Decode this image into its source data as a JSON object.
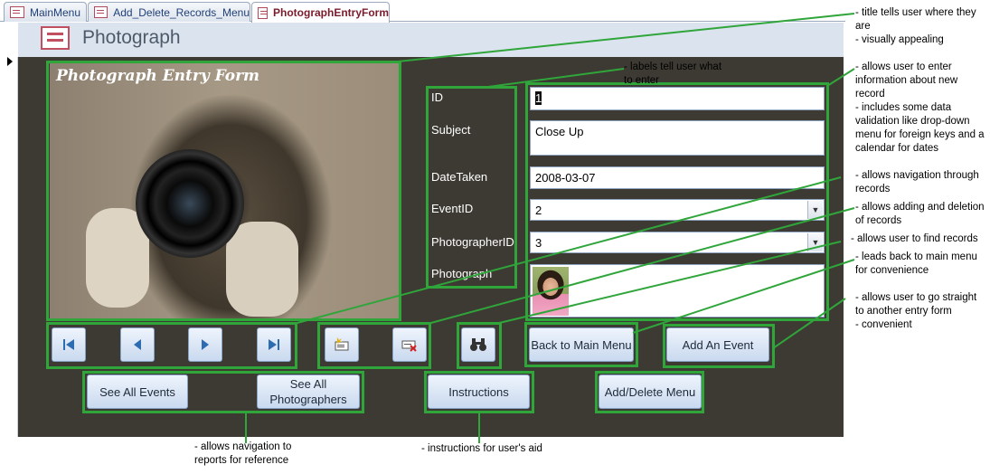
{
  "tabs": [
    {
      "label": "MainMenu",
      "active": false
    },
    {
      "label": "Add_Delete_Records_Menu",
      "active": false
    },
    {
      "label": "PhotographEntryForm",
      "active": true
    }
  ],
  "header": {
    "title": "Photograph",
    "icon": "form-icon"
  },
  "form": {
    "photo_title": "Photograph Entry Form",
    "labels": {
      "id": "ID",
      "subject": "Subject",
      "date_taken": "DateTaken",
      "event_id": "EventID",
      "photographer_id": "PhotographerID",
      "photograph": "Photograph"
    },
    "values": {
      "id": "1",
      "subject": "Close Up",
      "date_taken": "2008-03-07",
      "event_id": "2",
      "photographer_id": "3"
    }
  },
  "navigation_icons": [
    "first-record-icon",
    "previous-record-icon",
    "next-record-icon",
    "last-record-icon"
  ],
  "record_icons": [
    "new-record-icon",
    "delete-record-icon",
    "find-record-icon"
  ],
  "buttons": {
    "back_to_main": "Back to Main Menu",
    "add_event": "Add An Event",
    "see_all_events": "See All Events",
    "see_all_photographers": "See All Photographers",
    "instructions": "Instructions",
    "add_delete_menu": "Add/Delete Menu"
  },
  "annotations": {
    "title": "- title tells user where they are\n- visually appealing",
    "labels": "- labels tell user what to enter",
    "fields": "- allows user to enter information about new record\n- includes some data validation like drop-down menu for foreign keys and a calendar for dates",
    "navigation": "- allows navigation through records",
    "add_delete": "- allows adding and deletion of records",
    "find": "- allows user to find records",
    "back": "- leads back to main menu for convenience",
    "entry_form": "- allows user to go straight to another entry form\n- convenient",
    "reports": "- allows navigation to reports for reference",
    "instructions": "- instructions for user's aid"
  },
  "colors": {
    "annotation_green": "#2fa53a",
    "form_background": "#3d3a33",
    "header_background": "#dbe3ee"
  }
}
